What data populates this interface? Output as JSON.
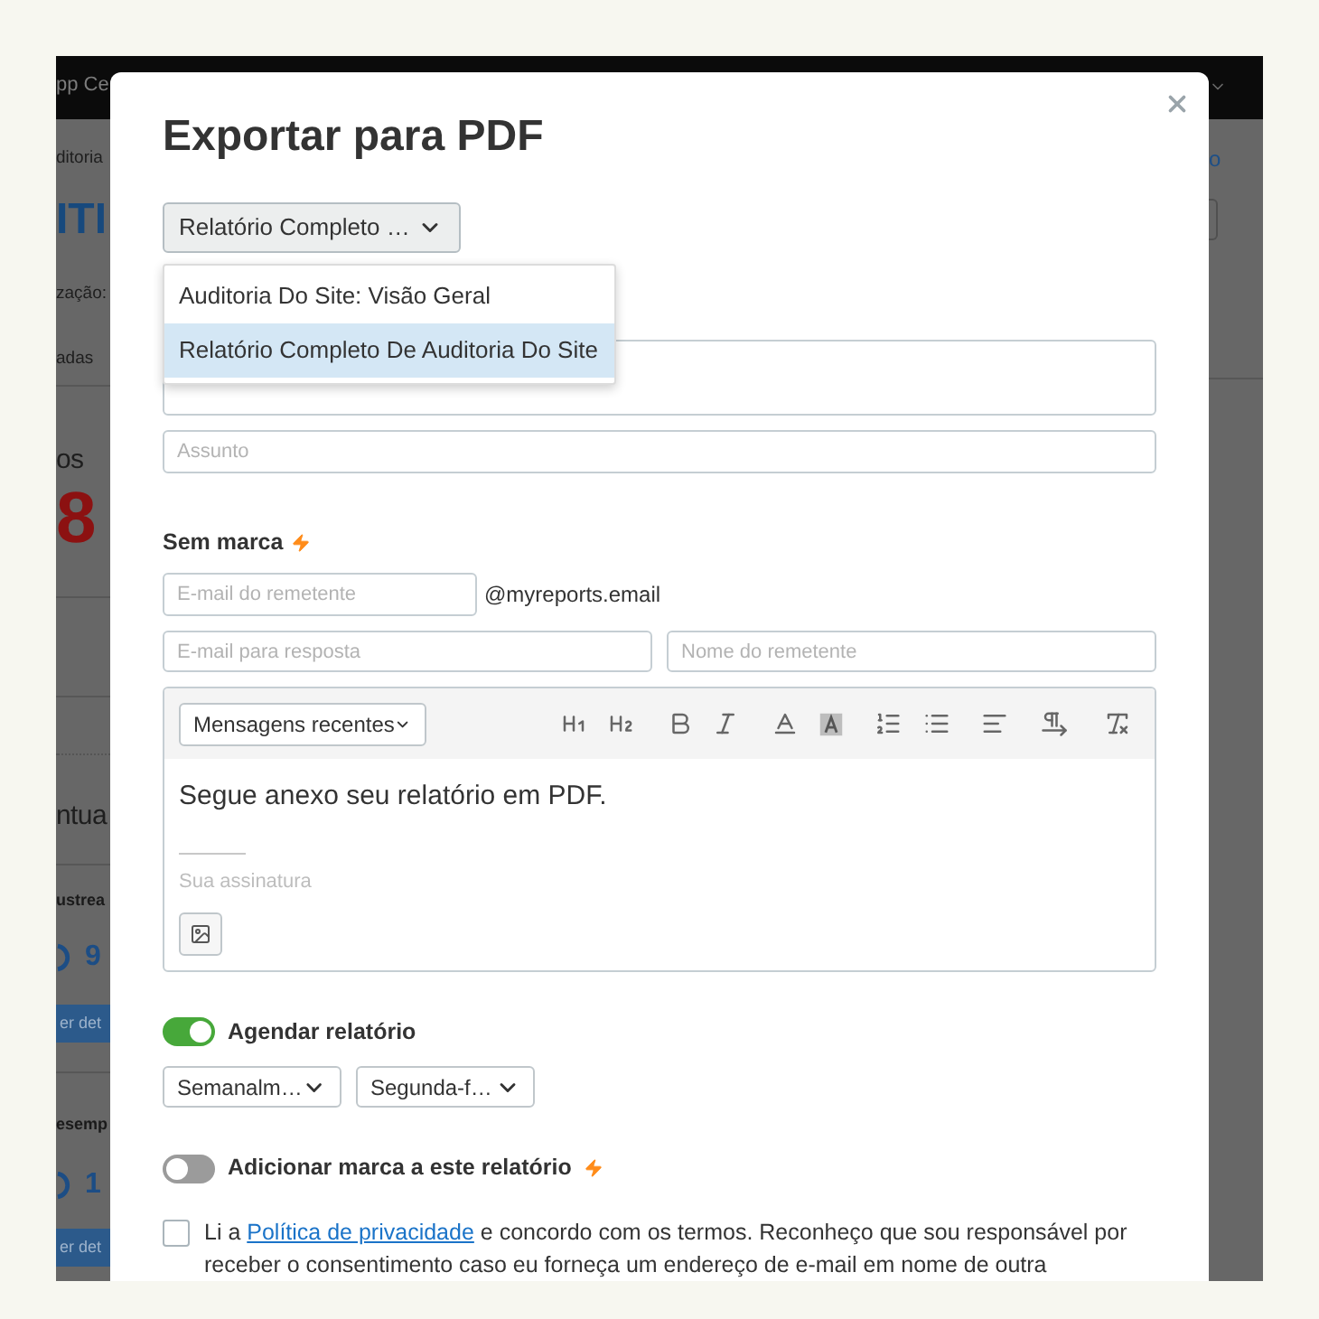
{
  "background": {
    "top_bar": {
      "text": "pp Ce"
    },
    "left_strip": [
      {
        "kind": "caption",
        "text": "ditoria"
      },
      {
        "kind": "title",
        "text": "ITI"
      },
      {
        "kind": "caption",
        "text": "zação:"
      },
      {
        "kind": "caption",
        "text": "adas"
      },
      {
        "kind": "divider"
      },
      {
        "kind": "metric_label",
        "text": "os"
      },
      {
        "kind": "metric_value",
        "text": "8"
      },
      {
        "kind": "divider"
      },
      {
        "kind": "divider"
      },
      {
        "kind": "dotted_divider"
      },
      {
        "kind": "metric_label",
        "text": "ntua"
      },
      {
        "kind": "divider"
      },
      {
        "kind": "section",
        "text": "ustrea"
      },
      {
        "kind": "score",
        "text": "9"
      },
      {
        "kind": "button",
        "text": "er det"
      },
      {
        "kind": "divider"
      },
      {
        "kind": "section",
        "text": "esemp"
      },
      {
        "kind": "score",
        "text": "1"
      },
      {
        "kind": "button",
        "text": "er det"
      }
    ],
    "right_strip": [
      {
        "kind": "link",
        "text": "o"
      },
      {
        "kind": "box"
      },
      {
        "kind": "divider"
      }
    ]
  },
  "dialog": {
    "title": "Exportar para PDF",
    "report_select": {
      "value": "Relatório Completo …",
      "expanded": true,
      "options": [
        {
          "label": "Auditoria Do Site: Visão Geral",
          "selected": false
        },
        {
          "label": "Relatório Completo De Auditoria Do Site",
          "selected": true
        }
      ]
    },
    "recipients": {
      "kind": "textarea"
    },
    "subject": {
      "placeholder": "Assunto"
    },
    "branding": {
      "label": "Sem marca",
      "premium": true
    },
    "sender_email": {
      "placeholder": "E-mail do remetente",
      "suffix": "@myreports.email"
    },
    "reply_email": {
      "placeholder": "E-mail para resposta"
    },
    "sender_name": {
      "placeholder": "Nome do remetente"
    },
    "editor": {
      "template_select": {
        "value": "Mensagens recentes"
      },
      "toolbar": [
        {
          "kind": "heading1"
        },
        {
          "kind": "heading2"
        },
        {
          "kind": "bold"
        },
        {
          "kind": "italic"
        },
        {
          "kind": "text_color"
        },
        {
          "kind": "highlight"
        },
        {
          "kind": "ordered_list"
        },
        {
          "kind": "bullet_list"
        },
        {
          "kind": "align"
        },
        {
          "kind": "paragraph_direction"
        },
        {
          "kind": "clear_format"
        }
      ],
      "body": "Segue anexo seu relatório em PDF.",
      "signature": {
        "placeholder": "Sua assinatura"
      }
    },
    "schedule": {
      "label": "Agendar relatório",
      "on": true,
      "selects": [
        "Semanalm…",
        "Segunda-f…"
      ]
    },
    "add_brand": {
      "label": "Adicionar marca a este relatório",
      "on": false,
      "premium": true
    },
    "consent": {
      "checked": false,
      "text_before": "Li a",
      "link": "Política de privacidade",
      "text_after": "e concordo com os termos. Reconheço que sou responsável por receber o consentimento caso eu forneça um endereço de e-mail em nome de outra"
    }
  }
}
